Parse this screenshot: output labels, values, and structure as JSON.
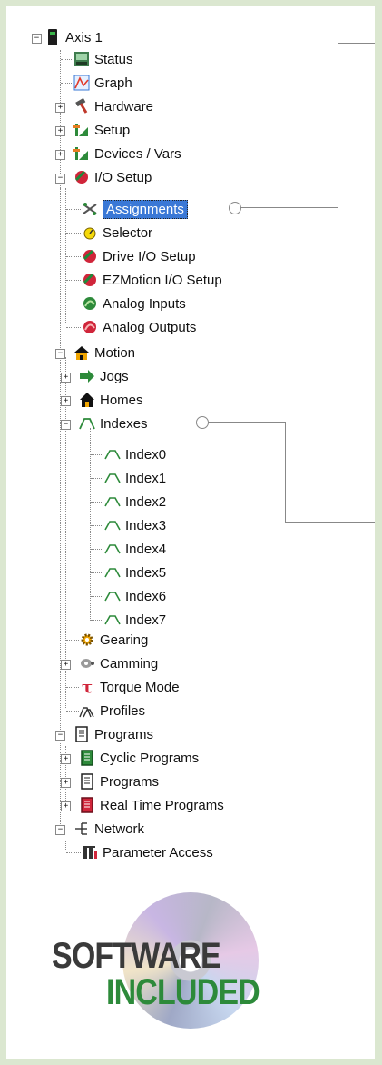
{
  "tree": {
    "axis": "Axis 1",
    "status": "Status",
    "graph": "Graph",
    "hardware": "Hardware",
    "setup": "Setup",
    "devices": "Devices / Vars",
    "io_setup": "I/O Setup",
    "assignments": "Assignments",
    "selector": "Selector",
    "drive_io": "Drive I/O Setup",
    "ezmotion_io": "EZMotion I/O Setup",
    "analog_inputs": "Analog Inputs",
    "analog_outputs": "Analog Outputs",
    "motion": "Motion",
    "jogs": "Jogs",
    "homes": "Homes",
    "indexes": "Indexes",
    "index_items": [
      "Index0",
      "Index1",
      "Index2",
      "Index3",
      "Index4",
      "Index5",
      "Index6",
      "Index7"
    ],
    "gearing": "Gearing",
    "camming": "Camming",
    "torque_mode": "Torque Mode",
    "profiles": "Profiles",
    "programs": "Programs",
    "cyclic_programs": "Cyclic Programs",
    "programs_sub": "Programs",
    "real_time_programs": "Real Time Programs",
    "network": "Network",
    "parameter_access": "Parameter Access"
  },
  "badge": {
    "line1": "SOFTWARE",
    "line2": "INCLUDED"
  },
  "colors": {
    "page_bg": "#dbe7d0",
    "selection": "#3a78d6",
    "badge_green": "#2d8a3a"
  }
}
